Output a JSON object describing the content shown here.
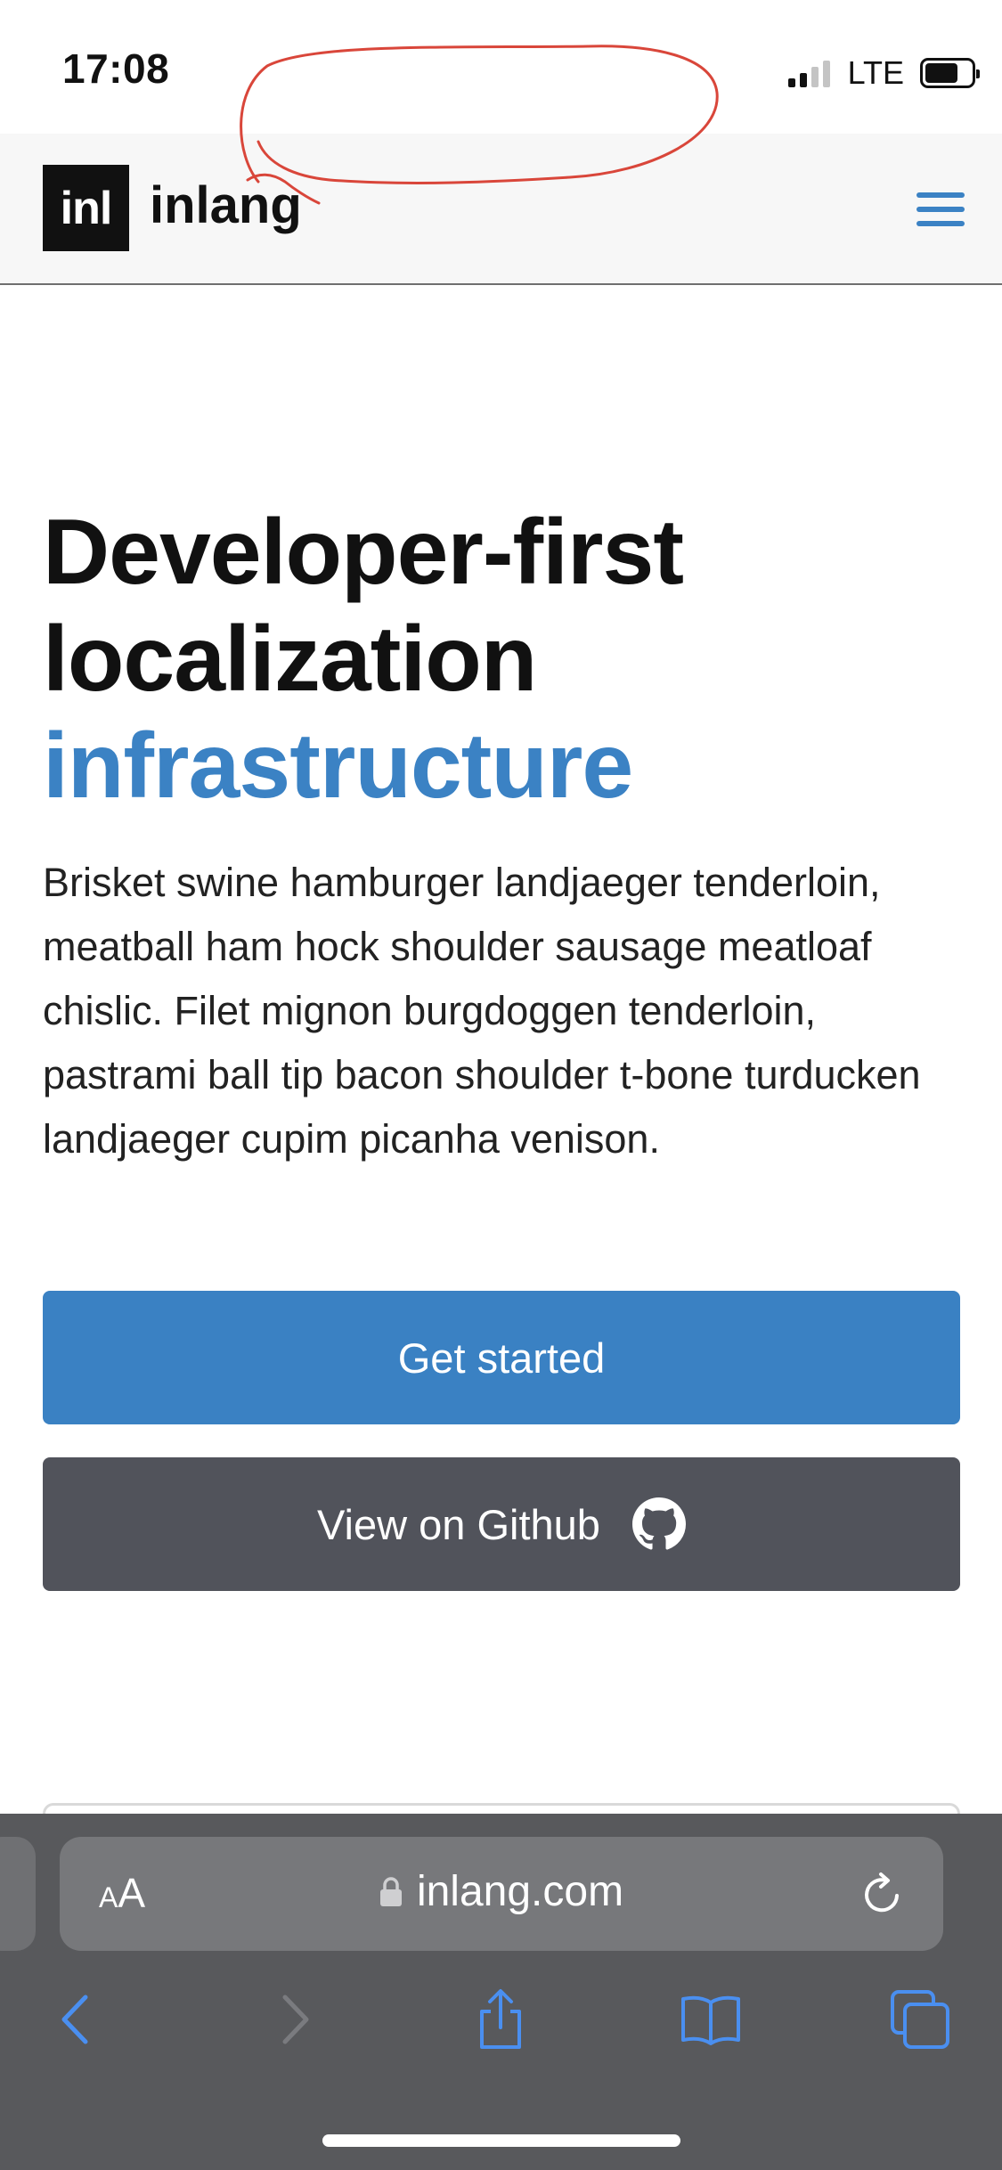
{
  "status_bar": {
    "time": "17:08",
    "network": "LTE"
  },
  "header": {
    "logo_text": "inl",
    "brand": "inlang",
    "menu_icon": "hamburger-menu-icon",
    "accent_color": "#3b82c4"
  },
  "hero": {
    "title_lines": [
      "Developer-first",
      "localization",
      "infrastructure"
    ],
    "description": "Brisket swine hamburger landjaeger tenderloin, meatball ham hock shoulder sausage meatloaf chislic. Filet mignon burgdoggen tenderloin, pastrami ball tip bacon shoulder t-bone turducken landjaeger cupim picanha venison.",
    "primary_button": "Get started",
    "secondary_button": "View on Github",
    "secondary_icon": "github-icon",
    "primary_color": "#3a81c3",
    "secondary_color": "#51535b"
  },
  "browser": {
    "text_size_label": "AA",
    "url": "inlang.com",
    "icons": [
      "lock-icon",
      "reload-icon",
      "back-icon",
      "forward-icon",
      "share-icon",
      "bookmarks-icon",
      "tabs-icon"
    ],
    "icon_color": "#4a8ff0"
  },
  "annotation": {
    "shape": "hand-drawn ellipse",
    "color": "#d9463a"
  }
}
